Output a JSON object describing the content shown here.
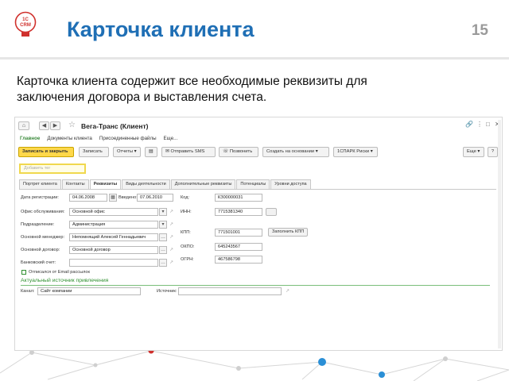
{
  "slide": {
    "title": "Карточка клиента",
    "page_number": "15",
    "subtitle": "Карточка клиента содержит все необходимые реквизиты для заключения договора и выставления счета.",
    "logo_text": "1С CRM"
  },
  "app": {
    "window_title": "Вега-Транс (Клиент)",
    "sections": [
      "Главное",
      "Документы клиента",
      "Присоединенные файлы",
      "Еще..."
    ],
    "toolbar": {
      "save_close": "Записать и закрыть",
      "save": "Записать",
      "reports": "Отчеты",
      "send_sms": "Отправить SMS",
      "call": "Позвонить",
      "create_based": "Создать на основании",
      "spark": "1СПАРК Риски",
      "more": "Еще",
      "help": "?"
    },
    "search_placeholder": "Добавить тег",
    "tabs": [
      "Портрет клиента",
      "Контакты",
      "Реквизиты",
      "Виды деятельности",
      "Дополнительные реквизиты",
      "Потенциалы",
      "Уровни доступа"
    ],
    "active_tab": "Реквизиты",
    "fields": {
      "reg_date_label": "Дата регистрации:",
      "reg_date": "04.06.2008",
      "entered_label": "Введено:",
      "entered": "07.06.2010",
      "office_label": "Офис обслуживания:",
      "office": "Основной офис",
      "division_label": "Подразделение:",
      "division": "Администрация",
      "manager_label": "Основной менеджер:",
      "manager": "Непомнящий Алексей Геннадьевич",
      "contract_label": "Основной договор:",
      "contract": "Основной договор",
      "bank_label": "Банковский счет:",
      "bank": "",
      "code_label": "Код:",
      "code": "КЗ00000031",
      "inn_label": "ИНН:",
      "inn": "7715381340",
      "kpp_label": "КПП:",
      "kpp": "771501001",
      "fill_kpp": "Заполнить КПП",
      "okpo_label": "ОКПО:",
      "okpo": "645243567",
      "ogrn_label": "ОГРН:",
      "ogrn": "467586798",
      "email_unsub": "Отписался от Email рассылок",
      "source_section": "Актуальный источник привлечения",
      "channel_label": "Канал:",
      "channel": "Сайт компании",
      "source_label": "Источник:",
      "source": ""
    }
  },
  "colors": {
    "title_blue": "#1f6fb5",
    "accent_yellow": "#ffd84a",
    "green": "#2f8f2f",
    "logo_red": "#d0312d"
  }
}
